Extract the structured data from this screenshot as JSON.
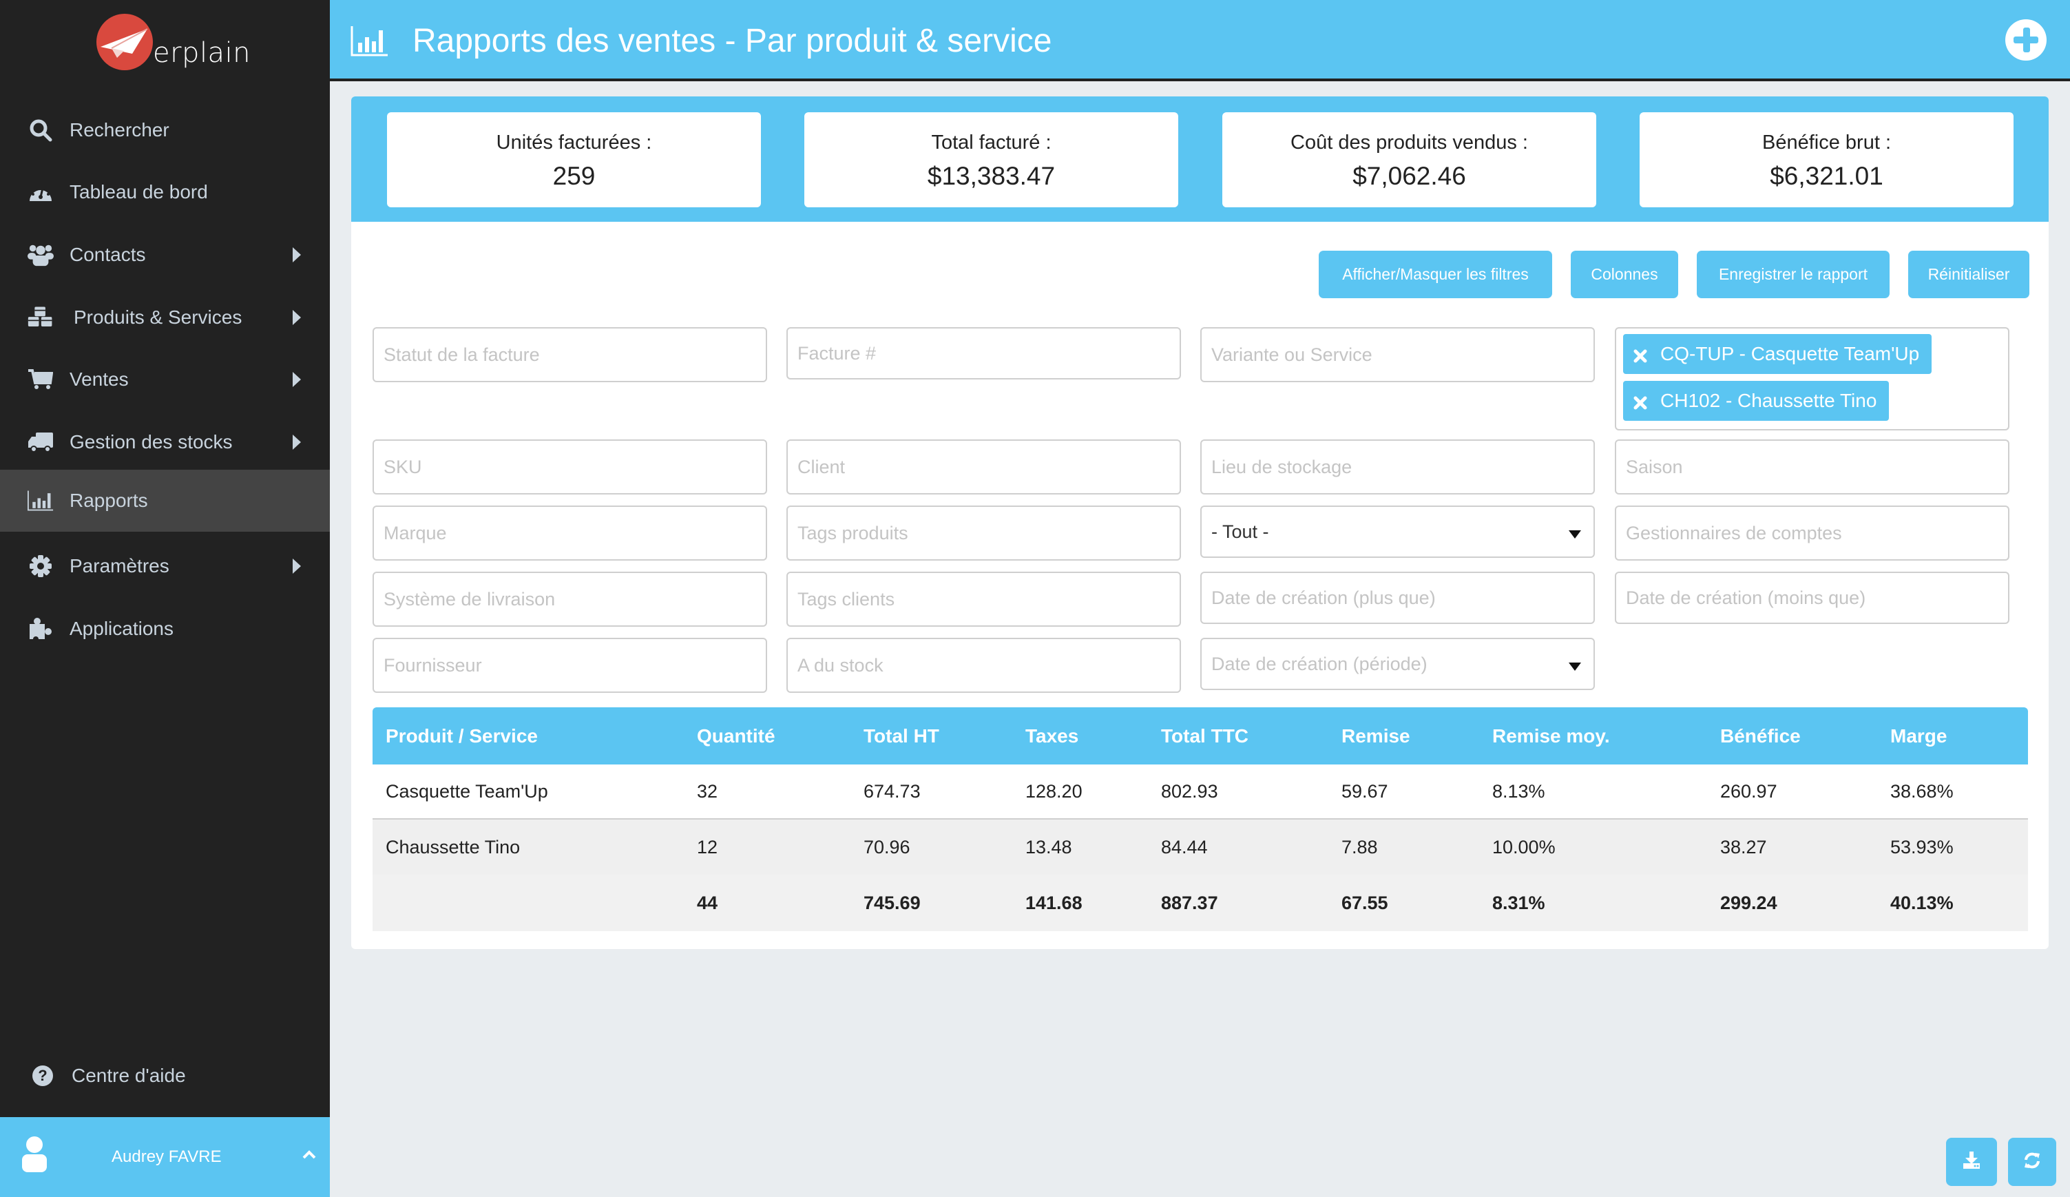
{
  "app": {
    "logo_text": "erplain"
  },
  "sidebar": {
    "items": [
      {
        "label": "Rechercher",
        "icon": "search-icon",
        "has_submenu": false
      },
      {
        "label": "Tableau de bord",
        "icon": "dashboard-gauge-icon",
        "has_submenu": false
      },
      {
        "label": "Contacts",
        "icon": "users-icon",
        "has_submenu": true
      },
      {
        "label": "Produits & Services",
        "icon": "cubes-icon",
        "has_submenu": true
      },
      {
        "label": "Ventes",
        "icon": "cart-icon",
        "has_submenu": true
      },
      {
        "label": "Gestion des stocks",
        "icon": "truck-icon",
        "has_submenu": true
      },
      {
        "label": "Rapports",
        "icon": "bar-chart-icon",
        "has_submenu": false,
        "active": true
      },
      {
        "label": "Paramètres",
        "icon": "gear-icon",
        "has_submenu": true
      },
      {
        "label": "Applications",
        "icon": "puzzle-icon",
        "has_submenu": false
      }
    ],
    "help": {
      "label": "Centre d'aide",
      "icon": "question-circle-icon"
    },
    "user": {
      "name": "Audrey FAVRE",
      "icon": "user-icon"
    }
  },
  "header": {
    "title": "Rapports des ventes - Par produit & service",
    "icon": "bar-chart-icon",
    "add_icon": "plus-circle-icon"
  },
  "summary": [
    {
      "label": "Unités facturées :",
      "value": "259"
    },
    {
      "label": "Total facturé :",
      "value": "$13,383.47"
    },
    {
      "label": "Coût des produits vendus :",
      "value": "$7,062.46"
    },
    {
      "label": "Bénéfice brut :",
      "value": "$6,321.01"
    }
  ],
  "toolbar": {
    "toggle_filters": "Afficher/Masquer les filtres",
    "columns": "Colonnes",
    "save_report": "Enregistrer le rapport",
    "reset": "Réinitialiser"
  },
  "filters": {
    "invoice_status": {
      "placeholder": "Statut de la facture",
      "value": ""
    },
    "invoice_number": {
      "placeholder": "Facture #",
      "value": ""
    },
    "variant_or_service": {
      "placeholder": "Variante ou Service",
      "value": ""
    },
    "selected_products": [
      {
        "label": "CQ-TUP - Casquette Team'Up"
      },
      {
        "label": "CH102 - Chaussette Tino"
      }
    ],
    "sku": {
      "placeholder": "SKU",
      "value": ""
    },
    "client": {
      "placeholder": "Client",
      "value": ""
    },
    "storage_location": {
      "placeholder": "Lieu de stockage",
      "value": ""
    },
    "season": {
      "placeholder": "Saison",
      "value": ""
    },
    "brand": {
      "placeholder": "Marque",
      "value": ""
    },
    "product_tags": {
      "placeholder": "Tags produits",
      "value": ""
    },
    "type_select": {
      "value": "- Tout -"
    },
    "account_managers": {
      "placeholder": "Gestionnaires de comptes",
      "value": ""
    },
    "shipping_system": {
      "placeholder": "Système de livraison",
      "value": ""
    },
    "client_tags": {
      "placeholder": "Tags clients",
      "value": ""
    },
    "created_after": {
      "placeholder": "Date de création (plus que)",
      "value": ""
    },
    "created_before": {
      "placeholder": "Date de création (moins que)",
      "value": ""
    },
    "supplier": {
      "placeholder": "Fournisseur",
      "value": ""
    },
    "has_stock": {
      "placeholder": "A du stock",
      "value": ""
    },
    "created_period": {
      "placeholder": "Date de création (période)",
      "value": ""
    }
  },
  "table": {
    "columns": [
      "Produit / Service",
      "Quantité",
      "Total HT",
      "Taxes",
      "Total TTC",
      "Remise",
      "Remise moy.",
      "Bénéfice",
      "Marge"
    ],
    "rows": [
      [
        "Casquette Team'Up",
        "32",
        "674.73",
        "128.20",
        "802.93",
        "59.67",
        "8.13%",
        "260.97",
        "38.68%"
      ],
      [
        "Chaussette Tino",
        "12",
        "70.96",
        "13.48",
        "84.44",
        "7.88",
        "10.00%",
        "38.27",
        "53.93%"
      ]
    ],
    "totals": [
      "",
      "44",
      "745.69",
      "141.68",
      "887.37",
      "67.55",
      "8.31%",
      "299.24",
      "40.13%"
    ]
  },
  "fabs": {
    "download_icon": "download-icon",
    "refresh_icon": "refresh-icon"
  },
  "colors": {
    "accent": "#5bc5f2",
    "sidebar_bg": "#222222",
    "sidebar_active": "#444444",
    "logo_red": "#d9493e"
  }
}
